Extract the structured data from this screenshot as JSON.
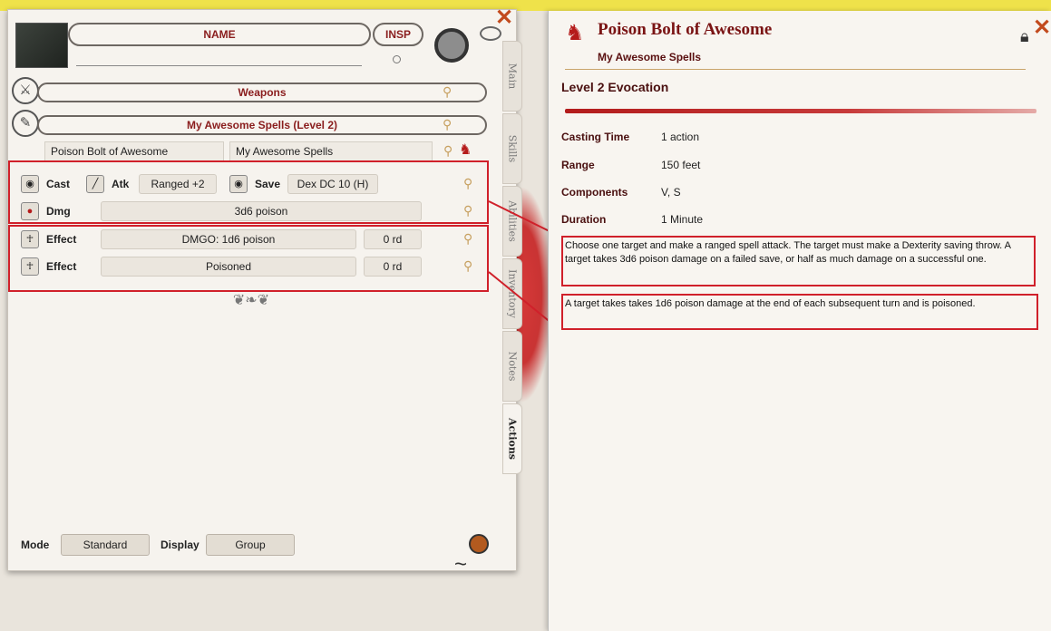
{
  "sheet": {
    "name_label": "NAME",
    "insp_label": "INSP",
    "weapons_group": "Weapons",
    "spells_group": "My Awesome Spells (Level 2)",
    "spell_name": "Poison Bolt of Awesome",
    "spell_group_name": "My Awesome Spells",
    "rows": {
      "cast": {
        "label": "Cast",
        "atk_label": "Atk",
        "atk_value": "Ranged +2",
        "save_label": "Save",
        "save_value": "Dex DC 10 (H)"
      },
      "dmg": {
        "label": "Dmg",
        "value": "3d6 poison"
      },
      "effect1": {
        "label": "Effect",
        "value": "DMGO: 1d6 poison",
        "duration": "0 rd"
      },
      "effect2": {
        "label": "Effect",
        "value": "Poisoned",
        "duration": "0 rd"
      }
    },
    "tabs": [
      "Main",
      "Skills",
      "Abilities",
      "Inventory",
      "Notes",
      "Actions"
    ],
    "active_tab": "Actions",
    "mode_label": "Mode",
    "mode_value": "Standard",
    "display_label": "Display",
    "display_value": "Group"
  },
  "detail": {
    "title": "Poison Bolt of Awesome",
    "subtitle": "My Awesome Spells",
    "level": "Level 2 Evocation",
    "props": [
      {
        "label": "Casting Time",
        "value": "1 action"
      },
      {
        "label": "Range",
        "value": "150 feet"
      },
      {
        "label": "Components",
        "value": "V, S"
      },
      {
        "label": "Duration",
        "value": "1 Minute"
      }
    ],
    "description_1": "Choose one target and make a ranged spell attack. The target must make a Dexterity saving throw. A target takes 3d6 poison damage on a failed save, or half as much damage on a successful one.",
    "description_2": "A target takes takes 1d6 poison damage at the end of each subsequent turn and is poisoned."
  },
  "icons": {
    "close": "close-x-icon",
    "lock": "lock-icon",
    "dragon": "dragon-icon",
    "chat": "chat-icon"
  },
  "colors": {
    "accent_red": "#b31c1c",
    "highlight": "#d0202a",
    "title": "#7a1414"
  }
}
